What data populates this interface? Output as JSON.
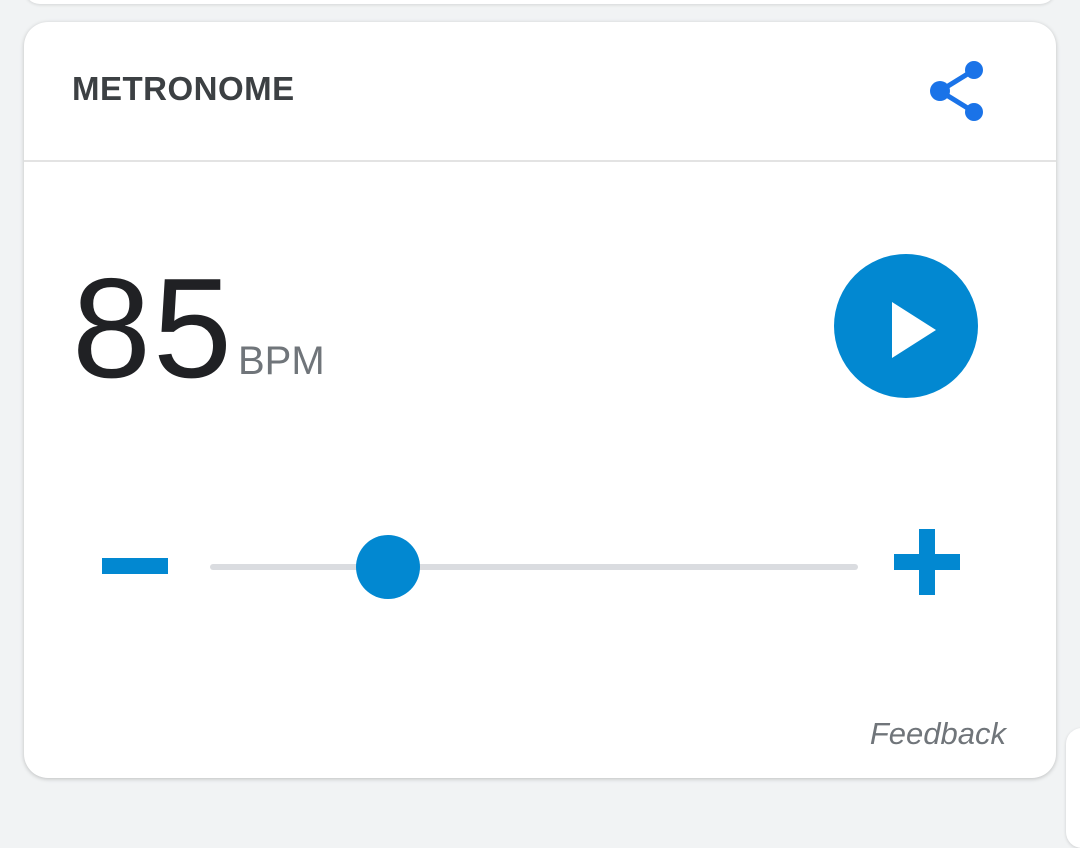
{
  "card": {
    "title": "METRONOME",
    "share_icon": "share-icon",
    "accent_color": "#0288d1",
    "share_color": "#1a73e8"
  },
  "tempo": {
    "value": "85",
    "unit": "BPM",
    "slider_level": 0.275
  },
  "controls": {
    "play_icon": "play-icon",
    "decrease_icon": "minus-icon",
    "increase_icon": "plus-icon"
  },
  "footer": {
    "feedback_label": "Feedback"
  }
}
